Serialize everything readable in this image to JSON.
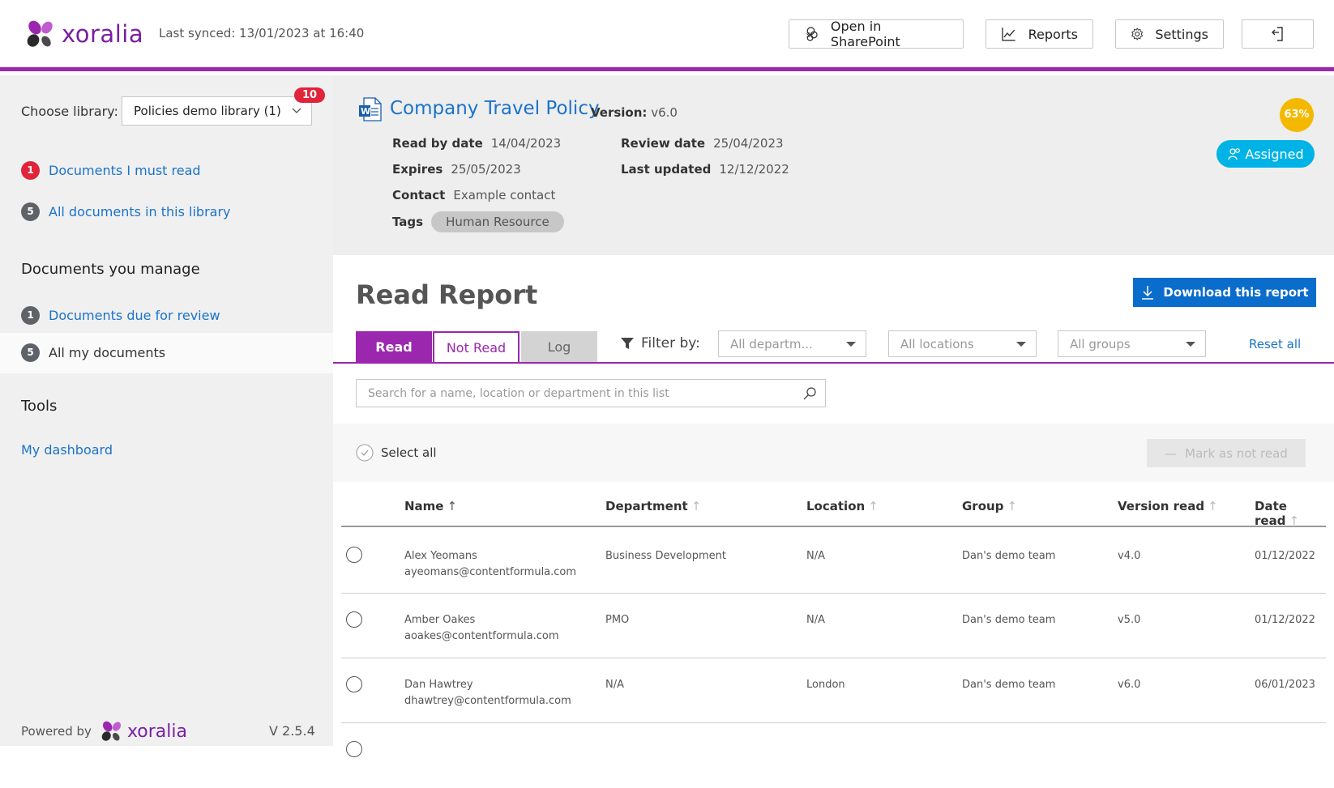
{
  "header": {
    "brand": "xoralia",
    "synced": "Last synced: 13/01/2023 at 16:40",
    "buttons": {
      "sharepoint": "Open in SharePoint",
      "reports": "Reports",
      "settings": "Settings"
    }
  },
  "sidebar": {
    "choose_label": "Choose library:",
    "library_value": "Policies demo library (1)",
    "library_badge": "10",
    "links": [
      {
        "count": "1",
        "label": "Documents I must read"
      },
      {
        "count": "5",
        "label": "All documents in this library"
      }
    ],
    "manage_heading": "Documents you manage",
    "manage_links": [
      {
        "count": "1",
        "label": "Documents due for review"
      },
      {
        "count": "5",
        "label": "All my documents"
      }
    ],
    "tools_heading": "Tools",
    "dashboard": "My dashboard",
    "powered_by": "Powered by",
    "powered_brand": "xoralia",
    "version": "V 2.5.4"
  },
  "document": {
    "title": "Company Travel Policy",
    "version_label": "Version:",
    "version": "v6.0",
    "read_by_label": "Read by date",
    "read_by": "14/04/2023",
    "review_label": "Review date",
    "review": "25/04/2023",
    "expires_label": "Expires",
    "expires": "25/05/2023",
    "updated_label": "Last updated",
    "updated": "12/12/2022",
    "contact_label": "Contact",
    "contact": "Example contact",
    "tags_label": "Tags",
    "tag": "Human Resource",
    "percent": "63%",
    "status": "Assigned"
  },
  "report": {
    "title": "Read Report",
    "download": "Download this report",
    "tabs": {
      "read": "Read",
      "not_read": "Not Read",
      "log": "Log"
    },
    "filter_by": "Filter by:",
    "filters": {
      "department": "All departm...",
      "location": "All locations",
      "group": "All groups"
    },
    "reset": "Reset all",
    "search_placeholder": "Search for a name, location or department in this list",
    "select_all": "Select all",
    "mark_not_read": "Mark as not read",
    "columns": {
      "name": "Name",
      "department": "Department",
      "location": "Location",
      "group": "Group",
      "version": "Version read",
      "date": "Date read"
    },
    "rows": [
      {
        "name": "Alex Yeomans",
        "email": "ayeomans@contentformula.com",
        "department": "Business Development",
        "location": "N/A",
        "group": "Dan's demo team",
        "version": "v4.0",
        "date": "01/12/2022"
      },
      {
        "name": "Amber Oakes",
        "email": "aoakes@contentformula.com",
        "department": "PMO",
        "location": "N/A",
        "group": "Dan's demo team",
        "version": "v5.0",
        "date": "01/12/2022"
      },
      {
        "name": "Dan Hawtrey",
        "email": "dhawtrey@contentformula.com",
        "department": "N/A",
        "location": "London",
        "group": "Dan's demo team",
        "version": "v6.0",
        "date": "06/01/2023"
      }
    ]
  }
}
